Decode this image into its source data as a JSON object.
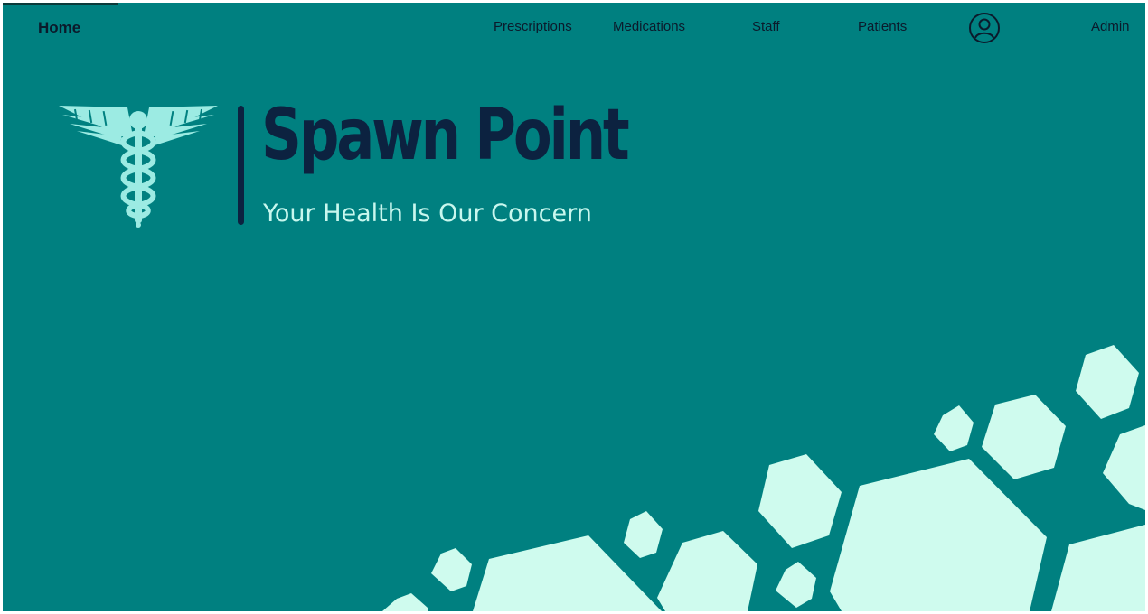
{
  "nav": {
    "home_label": "Home",
    "items": [
      {
        "label": "Prescriptions"
      },
      {
        "label": "Medications"
      },
      {
        "label": "Staff"
      },
      {
        "label": "Patients"
      }
    ],
    "account_label": "Admin",
    "account_icon": "user-circle-icon"
  },
  "hero": {
    "brand_name": "Spawn Point",
    "tagline": "Your Health Is Our Concern",
    "logo_icon": "caduceus-icon"
  },
  "colors": {
    "background": "#008080",
    "brand_dark": "#0c2240",
    "accent_mint": "#cffbee"
  }
}
